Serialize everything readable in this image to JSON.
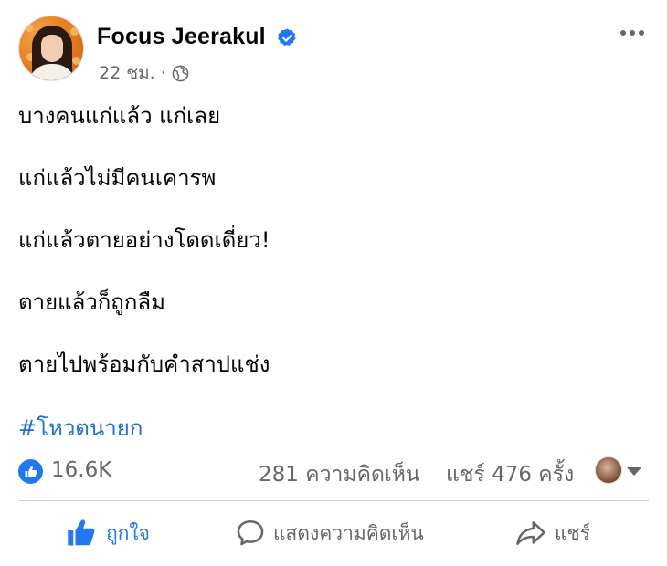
{
  "post": {
    "author": "Focus Jeerakul",
    "timestamp": "22 ชม.",
    "separator": "·",
    "verified_icon": "verified-badge-icon",
    "privacy_icon": "globe-icon",
    "lines": [
      "บางคนแก่แล้ว แก่เลย",
      "แก่แล้วไม่มีคนเคารพ",
      "แก่แล้วตายอย่างโดดเดี่ยว!",
      "ตายแล้วก็ถูกลืม",
      "ตายไปพร้อมกับคำสาปแช่ง"
    ],
    "hashtag": "#โหวตนายก"
  },
  "stats": {
    "likes": "16.6K",
    "comments": "281 ความคิดเห็น",
    "shares": "แชร์ 476 ครั้ง"
  },
  "actions": {
    "like": "ถูกใจ",
    "comment": "แสดงความคิดเห็น",
    "share": "แชร์"
  },
  "colors": {
    "accent": "#2078f4",
    "hashtag": "#216fdb",
    "muted": "#65676b"
  }
}
